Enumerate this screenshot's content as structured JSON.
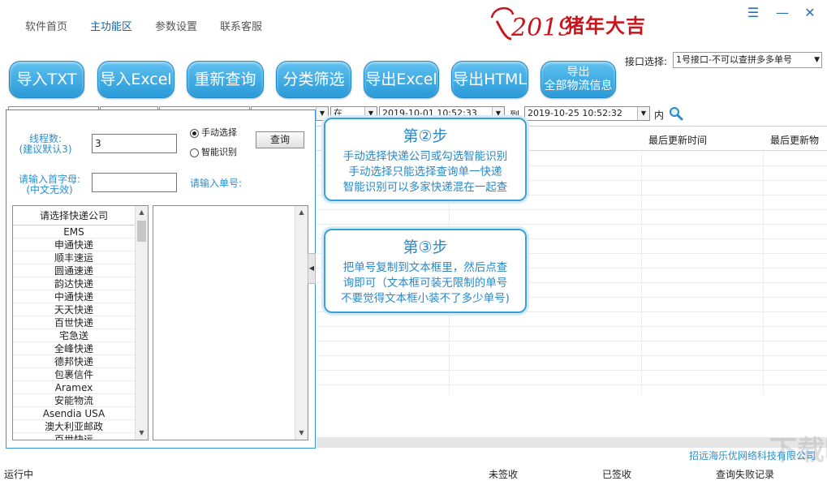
{
  "nav": {
    "items": [
      "软件首页",
      "主功能区",
      "参数设置",
      "联系客服"
    ],
    "active_index": 1,
    "logo_text": "猪年大吉",
    "logo_year": "2019"
  },
  "window_controls": {
    "menu": "☰",
    "minimize": "—",
    "close": "✕"
  },
  "toolbar": {
    "buttons": [
      {
        "label": "导入TXT"
      },
      {
        "label": "导入Excel"
      },
      {
        "label": "重新查询"
      },
      {
        "label": "分类筛选"
      },
      {
        "label": "导出Excel"
      },
      {
        "label": "导出HTML"
      },
      {
        "label_line1": "导出",
        "label_line2": "全部物流信息"
      }
    ],
    "accent_color": "#2a9ad8"
  },
  "interface": {
    "label": "接口选择:",
    "selected": "1号接口-不可以查拼多多单号"
  },
  "filter": {
    "match_value": "在",
    "date_from": "2019-10-01  10:52:33",
    "to_label": "到",
    "date_to": "2019-10-25  10:52:32",
    "within_label": "内"
  },
  "grid": {
    "headers": [
      "最后更新时间",
      "最后更新物"
    ]
  },
  "callouts": [
    {
      "title": "第②步",
      "lines": [
        "手动选择快递公司或勾选智能识别",
        "手动选择只能选择查询单一快递",
        "智能识别可以多家快递混在一起查"
      ]
    },
    {
      "title": "第③步",
      "lines": [
        "把单号复制到文本框里，然后点查",
        "询即可（文本框可装无限制的单号",
        "不要觉得文本框小装不了多少单号)"
      ]
    }
  ],
  "panel": {
    "threads_label_line1": "线程数:",
    "threads_label_line2": "(建议默认3)",
    "threads_value": "3",
    "radio_manual": "手动选择",
    "radio_smart": "智能识别",
    "query_button": "查询",
    "initial_label_line1": "请输入首字母:",
    "initial_label_line2": "(中文无效)",
    "initial_value": "",
    "tracking_label": "请输入单号:",
    "list_header": "请选择快递公司",
    "couriers": [
      "EMS",
      "申通快递",
      "顺丰速运",
      "圆通速递",
      "韵达快递",
      "中通快递",
      "天天快递",
      "百世快递",
      "宅急送",
      "全峰快递",
      "德邦快递",
      "包裹信件",
      "Aramex",
      "安能物流",
      "Asendia USA",
      "澳大利亚邮政",
      "百世快运"
    ]
  },
  "footer": {
    "company": "招远海乐优网络科技有限公司",
    "status_running": "运行中",
    "status_unsigned": "未签收",
    "status_signed": "已签收",
    "status_failed": "查询失败记录",
    "watermark": "下载吧"
  }
}
